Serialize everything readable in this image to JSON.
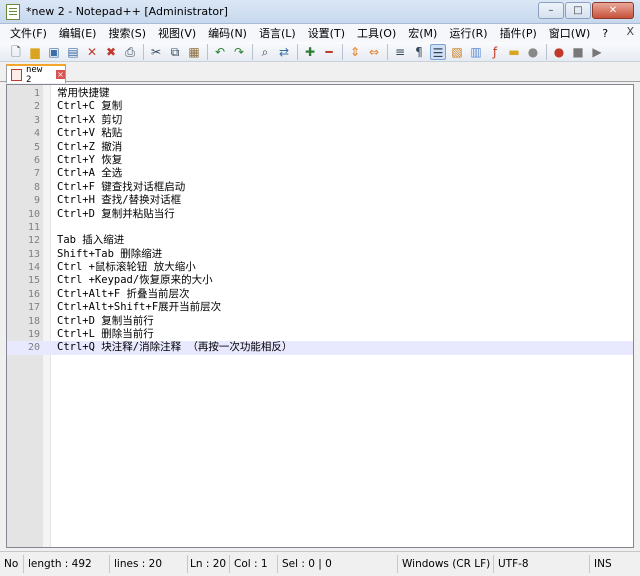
{
  "window": {
    "title": "*new 2 - Notepad++ [Administrator]",
    "minimize": "–",
    "maximize": "□",
    "close": "✕"
  },
  "menu": [
    "文件(F)",
    "编辑(E)",
    "搜索(S)",
    "视图(V)",
    "编码(N)",
    "语言(L)",
    "设置(T)",
    "工具(O)",
    "宏(M)",
    "运行(R)",
    "插件(P)",
    "窗口(W)",
    "?"
  ],
  "menu_close": "X",
  "toolbar_icons": [
    "new-file-icon",
    "open-file-icon",
    "save-icon",
    "save-all-icon",
    "close-icon",
    "close-all-icon",
    "print-icon",
    "cut-icon",
    "copy-icon",
    "paste-icon",
    "undo-icon",
    "redo-icon",
    "find-icon",
    "replace-icon",
    "zoom-in-icon",
    "zoom-out-icon",
    "sync-vertical-icon",
    "sync-horizontal-icon",
    "word-wrap-icon",
    "show-all-chars-icon",
    "indent-guide-icon",
    "doc-map-icon",
    "function-list-icon",
    "folder-workspace-icon",
    "monitoring-icon",
    "record-macro-icon",
    "stop-macro-icon",
    "play-macro-icon"
  ],
  "tab": {
    "label": "new 2"
  },
  "editor": {
    "current_line": 20,
    "lines": [
      "常用快捷键",
      "Ctrl+C 复制",
      "Ctrl+X 剪切",
      "Ctrl+V 粘贴",
      "Ctrl+Z 撤消",
      "Ctrl+Y 恢复",
      "Ctrl+A 全选",
      "Ctrl+F 键查找对话框启动",
      "Ctrl+H 查找/替换对话框",
      "Ctrl+D 复制并粘贴当行",
      "",
      "Tab 插入缩进",
      "Shift+Tab 删除缩进",
      "Ctrl +鼠标滚轮钮 放大缩小",
      "Ctrl +Keypad/恢复原来的大小",
      "Ctrl+Alt+F 折叠当前层次",
      "Ctrl+Alt+Shift+F展开当前层次",
      "Ctrl+D 复制当前行",
      "Ctrl+L 删除当前行",
      "Ctrl+Q 块注释/消除注释 （再按一次功能相反）"
    ]
  },
  "status": {
    "type": "No",
    "length": "length : 492",
    "lines": "lines : 20",
    "ln": "Ln : 20",
    "col": "Col : 1",
    "sel": "Sel : 0 | 0",
    "eol": "Windows (CR LF)",
    "encoding": "UTF-8",
    "mode": "INS"
  }
}
